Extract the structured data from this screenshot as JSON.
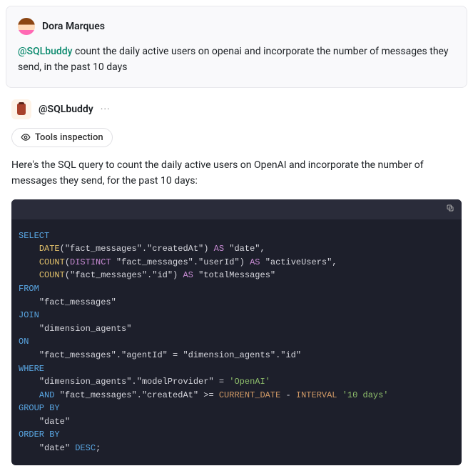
{
  "question": {
    "author": "Dora Marques",
    "mention": "@SQLbuddy",
    "text": " count the daily active users on openai and incorporate the number of messages they send, in the past 10 days"
  },
  "bot": {
    "name": "@SQLbuddy",
    "more": "···"
  },
  "tools_chip": "Tools inspection",
  "response_text": "Here's the SQL query to count the daily active users on OpenAI and incorporate the number of messages they send, for the past 10 days:",
  "sql": {
    "select": "SELECT",
    "date_fn": "DATE",
    "date_args": "(\"fact_messages\".\"createdAt\")",
    "as1": "AS",
    "date_alias": "\"date\"",
    "count1": "COUNT",
    "distinct": "DISTINCT",
    "count1_args": " \"fact_messages\".\"userId\")",
    "as2": "AS",
    "count1_alias": "\"activeUsers\"",
    "count2": "COUNT",
    "count2_args": "(\"fact_messages\".\"id\")",
    "as3": "AS",
    "count2_alias": "\"totalMessages\"",
    "from": "FROM",
    "from_tbl": "\"fact_messages\"",
    "join": "JOIN",
    "join_tbl": "\"dimension_agents\"",
    "on": "ON",
    "on_expr": "\"fact_messages\".\"agentId\" = \"dimension_agents\".\"id\"",
    "where": "WHERE",
    "where1_l": "\"dimension_agents\".\"modelProvider\" = ",
    "where1_r": "'OpenAI'",
    "and": "AND",
    "where2_l": " \"fact_messages\".\"createdAt\" >= ",
    "cur_date": "CURRENT_DATE",
    "minus": " - ",
    "interval_kw": "INTERVAL",
    "interval_val": " '10 days'",
    "group": "GROUP BY",
    "group_col": "\"date\"",
    "order": "ORDER BY",
    "order_col": "\"date\"",
    "desc": " DESC",
    "semi": ";"
  }
}
